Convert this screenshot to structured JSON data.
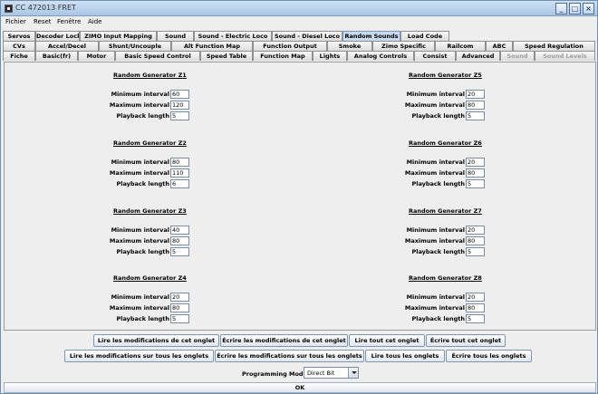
{
  "window": {
    "title": "CC 472013 FRET"
  },
  "menu": [
    "Fichier",
    "Reset",
    "Fenêtre",
    "Aide"
  ],
  "tabs": {
    "row1": [
      "Servos",
      "Decoder Lock",
      "ZIMO Input Mapping",
      "Sound",
      "Sound - Electric Loco",
      "Sound - Diesel Loco",
      "Random Sounds",
      "Load Code"
    ],
    "row2": [
      "CVs",
      "Accel/Decel",
      "Shunt/Uncouple",
      "Alt Function Map",
      "Function Output",
      "Smoke",
      "Zimo Specific",
      "Railcom",
      "ABC",
      "Speed Regulation"
    ],
    "row3": [
      "Fiche",
      "Basic(fr)",
      "Motor",
      "Basic Speed Control",
      "Speed Table",
      "Function Map",
      "Lights",
      "Analog Controls",
      "Consist",
      "Advanced",
      "Sound",
      "Sound Levels"
    ],
    "active": "Random Sounds"
  },
  "labels": {
    "min": "Minimum interval",
    "max": "Maximum interval",
    "len": "Playback length"
  },
  "generators": [
    {
      "title": "Random Generator Z1",
      "min": "60",
      "max": "120",
      "len": "5"
    },
    {
      "title": "Random Generator Z2",
      "min": "80",
      "max": "110",
      "len": "6"
    },
    {
      "title": "Random Generator Z3",
      "min": "40",
      "max": "80",
      "len": "5"
    },
    {
      "title": "Random Generator Z4",
      "min": "20",
      "max": "80",
      "len": "5"
    },
    {
      "title": "Random Generator Z5",
      "min": "20",
      "max": "80",
      "len": "5"
    },
    {
      "title": "Random Generator Z6",
      "min": "20",
      "max": "80",
      "len": "5"
    },
    {
      "title": "Random Generator Z7",
      "min": "20",
      "max": "80",
      "len": "5"
    },
    {
      "title": "Random Generator Z8",
      "min": "20",
      "max": "80",
      "len": "5"
    }
  ],
  "buttons": {
    "read_tab": "Lire les modifications de cet onglet",
    "write_tab": "Écrire les modifications de cet onglet",
    "read_all_tab": "Lire tout cet onglet",
    "write_all_tab": "Écrire tout cet onglet",
    "read_all_mods": "Lire les modifications sur tous les onglets",
    "write_all_mods": "Écrire les modifications sur tous les onglets",
    "read_all": "Lire tous les onglets",
    "write_all": "Écrire tous les onglets"
  },
  "programming": {
    "label": "Programming Mode",
    "value": "Direct Bit"
  },
  "ok": "OK"
}
